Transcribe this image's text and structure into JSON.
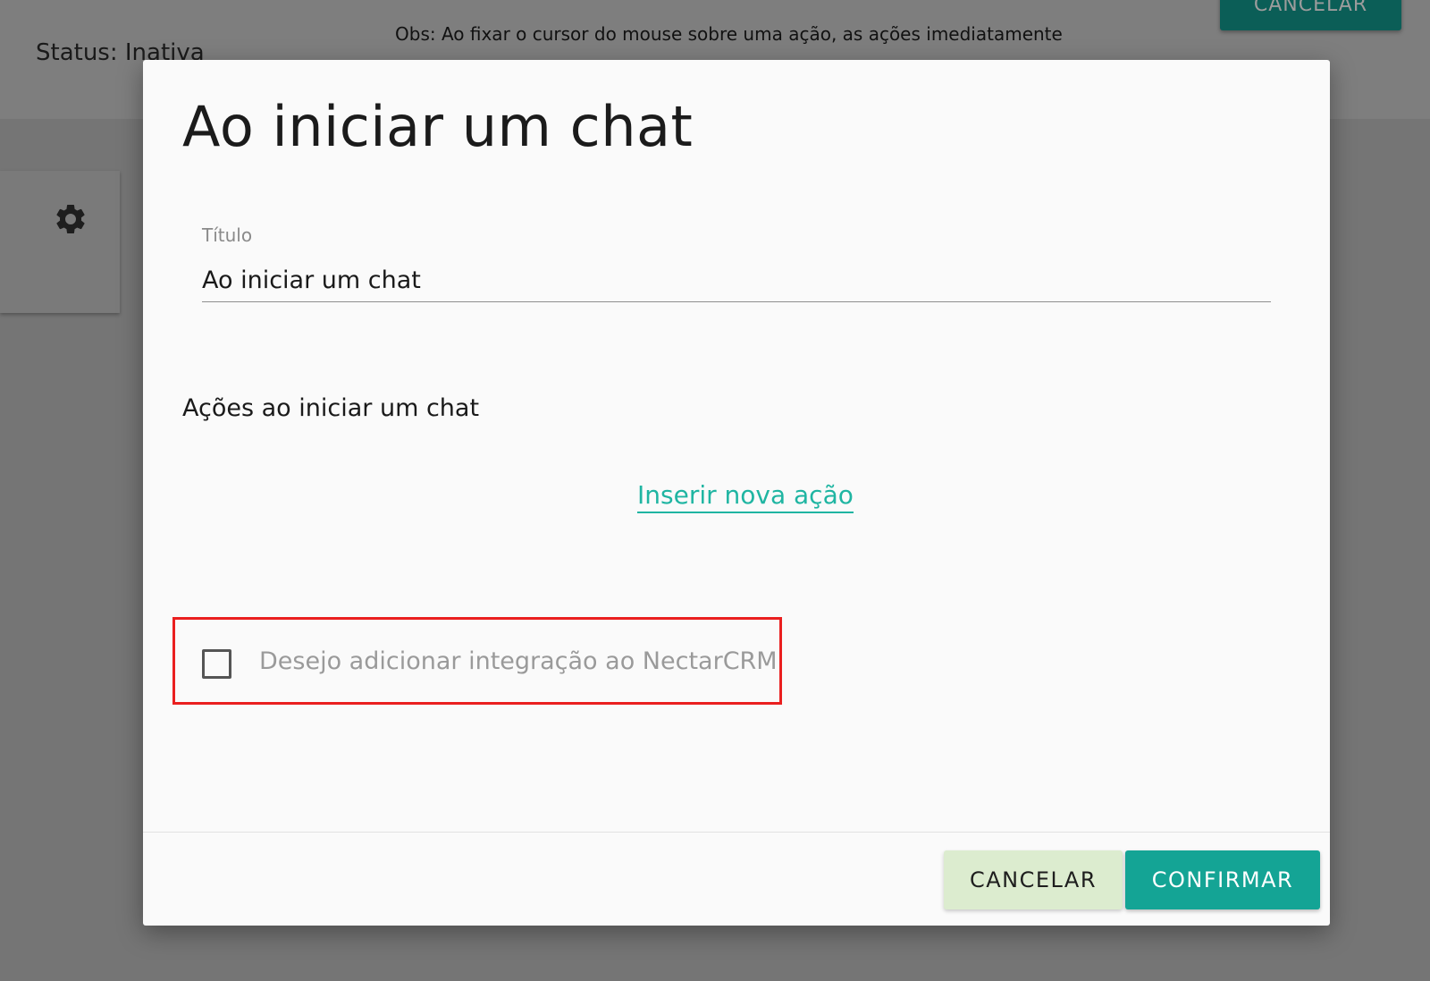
{
  "background": {
    "status": "Status: Inativa",
    "obs": "Obs: Ao fixar o cursor do mouse sobre uma ação, as ações imediatamente",
    "top_cancel_label": "CANCELAR",
    "settings_icon": "gear-icon"
  },
  "dialog": {
    "title": "Ao iniciar um chat",
    "title_field": {
      "label": "Título",
      "value": "Ao iniciar um chat"
    },
    "actions_heading": "Ações ao iniciar um chat",
    "insert_action_label": "Inserir nova ação",
    "nectar_integration": {
      "label": "Desejo adicionar integração ao NectarCRM",
      "checked": false
    },
    "cancel_label": "CANCELAR",
    "confirm_label": "CONFIRMAR"
  },
  "colors": {
    "accent": "#14a495",
    "link": "#1fb5a2",
    "highlight": "#ea1f1f",
    "cancel_bg": "#dceccf"
  }
}
